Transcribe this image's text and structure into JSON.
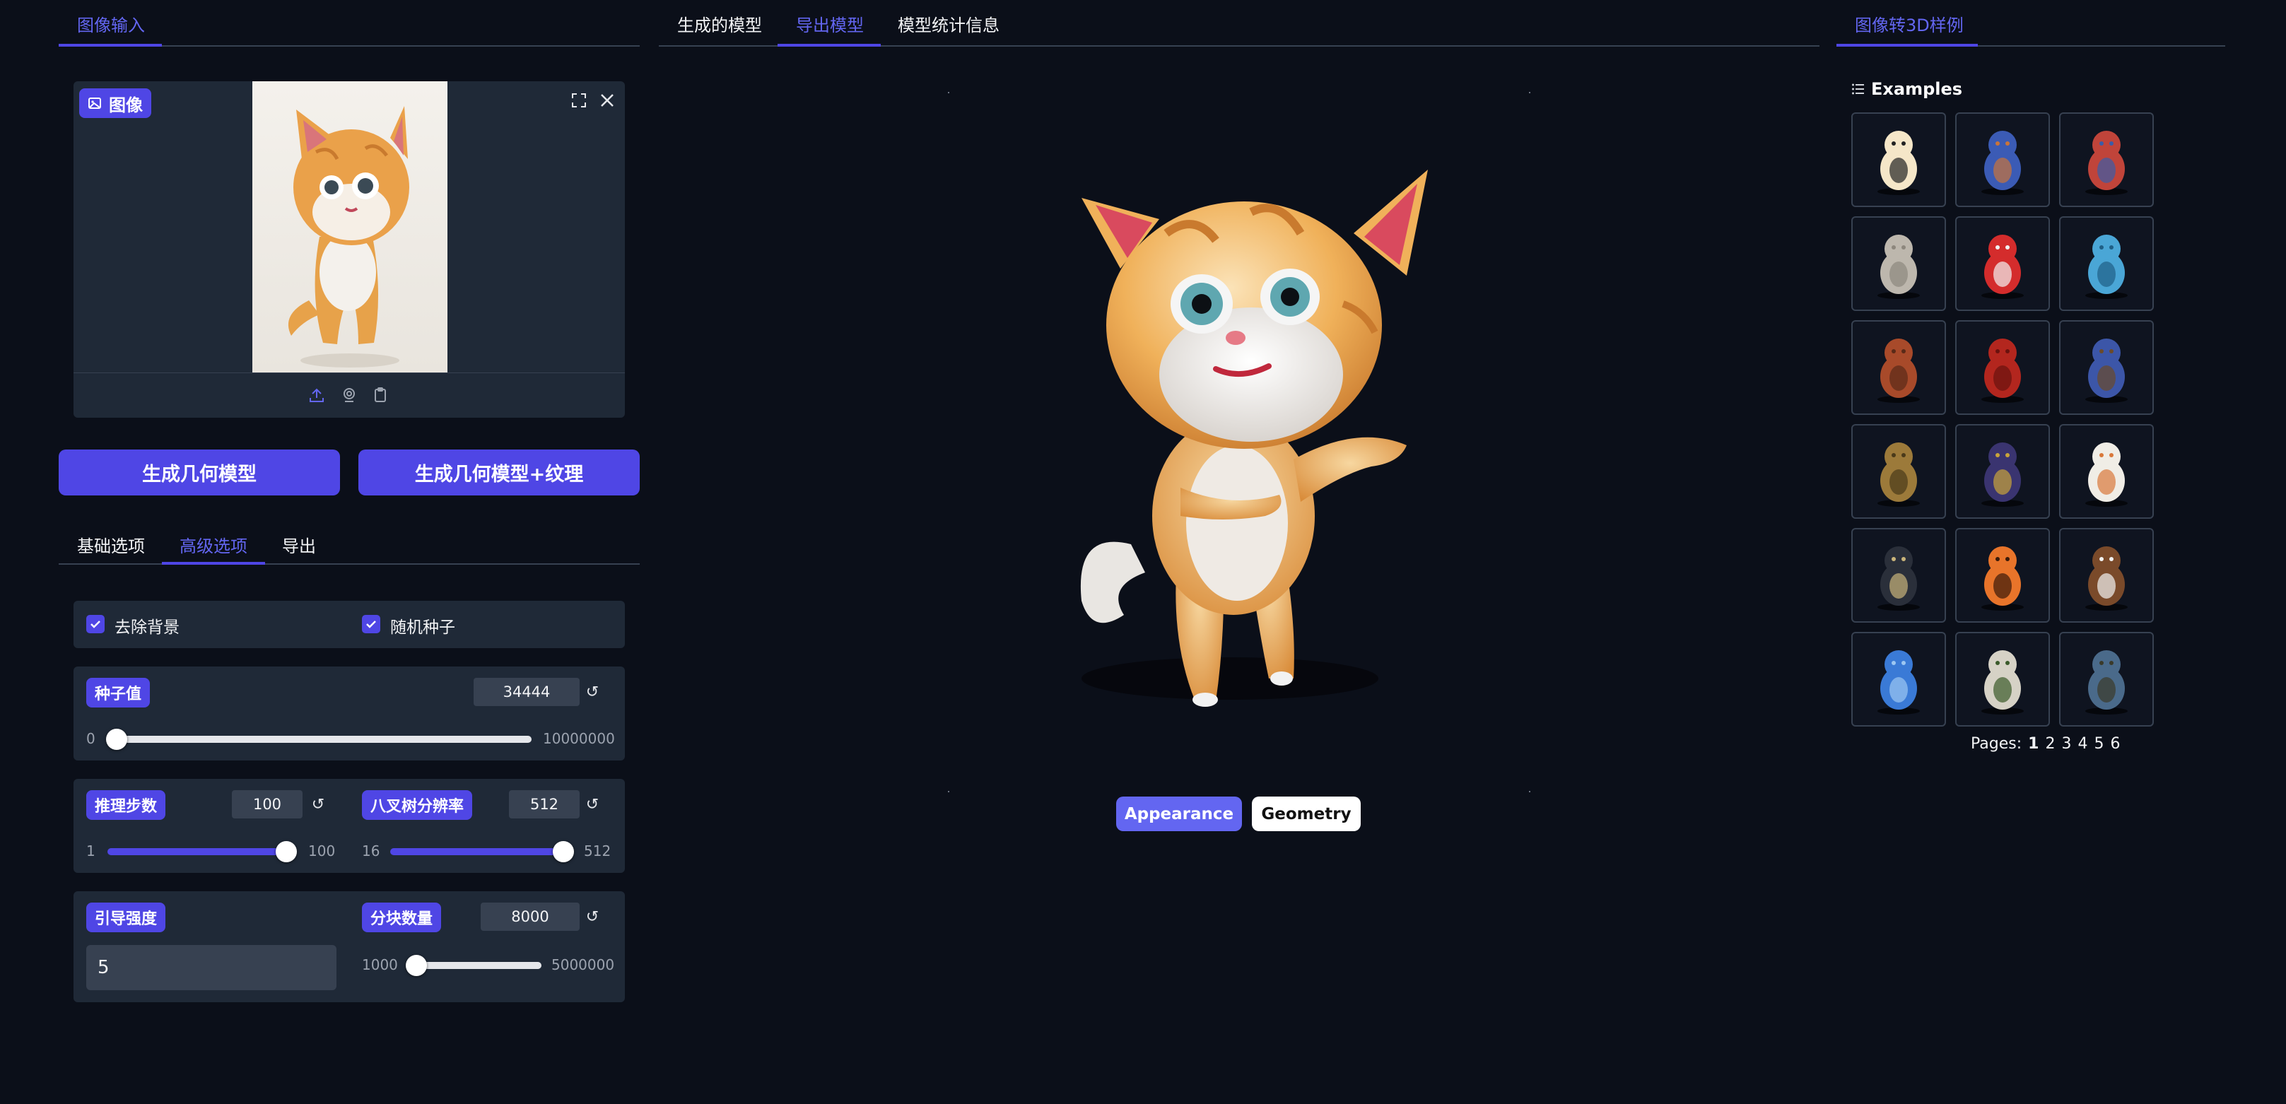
{
  "left": {
    "tab_label": "图像输入",
    "image_label": "图像",
    "buttons": {
      "geometry": "生成几何模型",
      "geometry_texture": "生成几何模型+纹理"
    },
    "option_tabs": [
      "基础选项",
      "高级选项",
      "导出"
    ],
    "remove_bg": "去除背景",
    "random_seed": "随机种子",
    "seed": {
      "label": "种子值",
      "value": "34444",
      "min": "0",
      "max": "10000000",
      "fraction": 0.0
    },
    "steps": {
      "label": "推理步数",
      "value": "100",
      "min": "1",
      "max": "100",
      "fraction": 1.0
    },
    "octree": {
      "label": "八叉树分辨率",
      "value": "512",
      "min": "16",
      "max": "512",
      "fraction": 1.0
    },
    "guidance": {
      "label": "引导强度",
      "value": "5"
    },
    "chunks": {
      "label": "分块数量",
      "value": "8000",
      "min": "1000",
      "max": "5000000",
      "fraction": 0.0
    }
  },
  "center": {
    "tabs": [
      "生成的模型",
      "导出模型",
      "模型统计信息"
    ],
    "modes": [
      "Appearance",
      "Geometry"
    ]
  },
  "right": {
    "tab_label": "图像转3D样例",
    "examples_title": "Examples",
    "examples": [
      "penguin-icon",
      "house-icon",
      "pirate-icon",
      "bust-icon",
      "santa-icon",
      "seahorse-icon",
      "train-icon",
      "horse-icon",
      "pistol-icon",
      "staff-icon",
      "witch-hat-icon",
      "dragon-icon",
      "lamp-post-icon",
      "pumpkin-icon",
      "eagle-icon",
      "stitch-icon",
      "castle-icon",
      "tree-orb-icon"
    ],
    "pages_label": "Pages:",
    "pages": [
      "1",
      "2",
      "3",
      "4",
      "5",
      "6"
    ]
  },
  "colors": {
    "accent": "#4f46e5",
    "bg": "#0b0f19",
    "panel": "#1f2937"
  }
}
